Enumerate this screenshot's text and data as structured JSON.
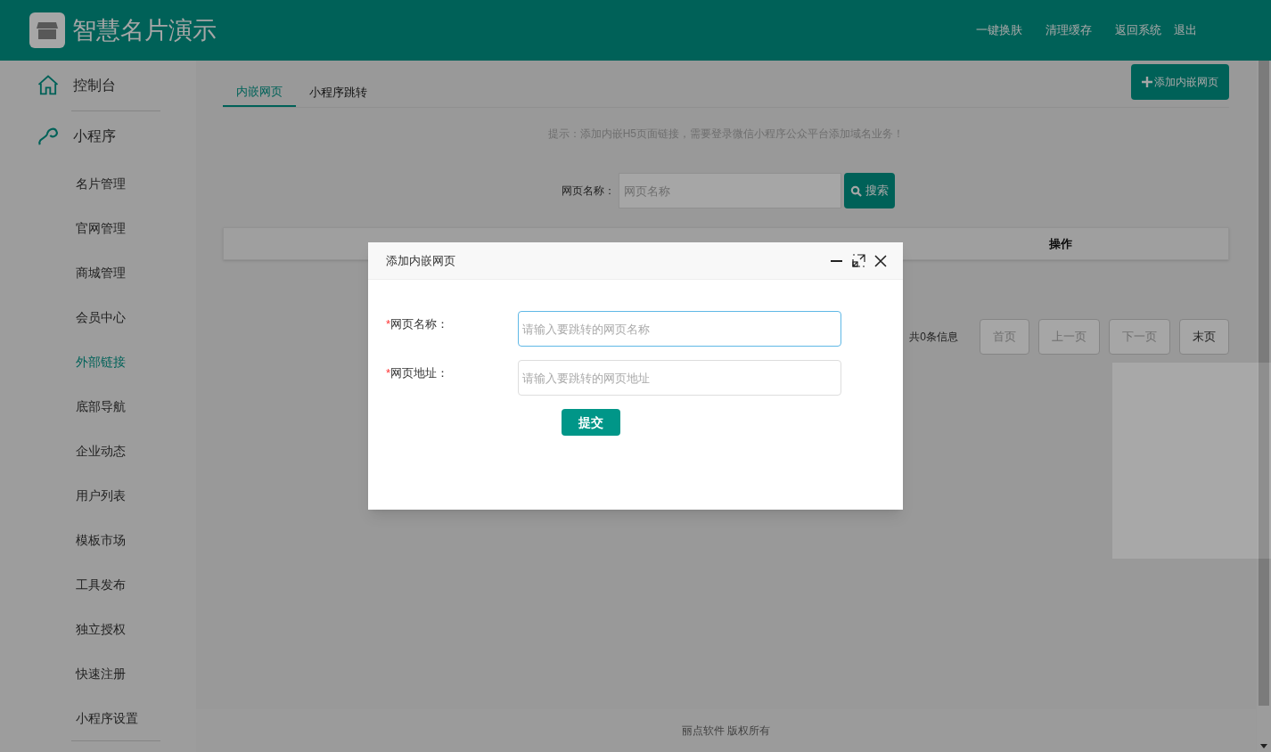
{
  "header": {
    "title": "智慧名片演示",
    "links": [
      "一键换肤",
      "清理缓存",
      "返回系统",
      "退出"
    ]
  },
  "sidebar": {
    "items": [
      {
        "label": "控制台",
        "kind": "section",
        "selected": false
      },
      {
        "label": "小程序",
        "kind": "section",
        "selected": false
      },
      {
        "label": "名片管理",
        "kind": "item",
        "selected": false
      },
      {
        "label": "官网管理",
        "kind": "item",
        "selected": false
      },
      {
        "label": "商城管理",
        "kind": "item",
        "selected": false
      },
      {
        "label": "会员中心",
        "kind": "item",
        "selected": false
      },
      {
        "label": "外部链接",
        "kind": "item",
        "selected": true
      },
      {
        "label": "底部导航",
        "kind": "item",
        "selected": false
      },
      {
        "label": "企业动态",
        "kind": "item",
        "selected": false
      },
      {
        "label": "用户列表",
        "kind": "item",
        "selected": false
      },
      {
        "label": "模板市场",
        "kind": "item",
        "selected": false
      },
      {
        "label": "工具发布",
        "kind": "item",
        "selected": false
      },
      {
        "label": "独立授权",
        "kind": "item",
        "selected": false
      },
      {
        "label": "快速注册",
        "kind": "item",
        "selected": false
      },
      {
        "label": "小程序设置",
        "kind": "item",
        "selected": false
      }
    ]
  },
  "tabs": [
    {
      "label": "内嵌网页",
      "selected": true
    },
    {
      "label": "小程序跳转",
      "selected": false
    }
  ],
  "add_button": "添加内嵌网页",
  "hint": "提示：添加内嵌H5页面链接，需要登录微信小程序公众平台添加域名业务！",
  "search": {
    "label": "网页名称：",
    "placeholder": "网页名称",
    "button": "搜索"
  },
  "table": {
    "columns": [
      {
        "label": "操作"
      }
    ]
  },
  "pagination": {
    "total": "共0条信息",
    "buttons": [
      {
        "label": "首页",
        "disabled": true
      },
      {
        "label": "上一页",
        "disabled": true
      },
      {
        "label": "下一页",
        "disabled": true
      },
      {
        "label": "末页",
        "disabled": false
      }
    ]
  },
  "footer": "丽点软件 版权所有",
  "dialog": {
    "title": "添加内嵌网页",
    "fields": [
      {
        "required_mark": "*",
        "label": "网页名称：",
        "placeholder": "请输入要跳转的网页名称",
        "focused": true
      },
      {
        "required_mark": "*",
        "label": "网页地址：",
        "placeholder": "请输入要跳转的网页地址",
        "focused": false
      }
    ],
    "submit": "提交"
  }
}
